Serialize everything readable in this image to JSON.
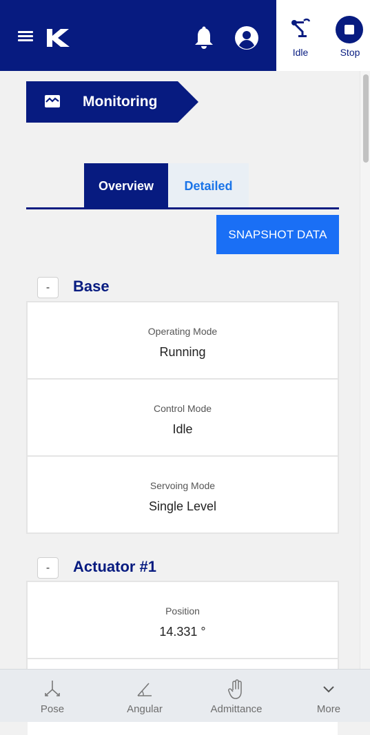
{
  "header": {
    "robot_status_label": "Idle",
    "stop_label": "Stop",
    "colors": {
      "primary": "#071b80",
      "accent": "#1a6ff5"
    }
  },
  "breadcrumb": {
    "label": "Monitoring",
    "icon": "monitoring-icon"
  },
  "tabs": [
    {
      "label": "Overview",
      "active": true
    },
    {
      "label": "Detailed",
      "active": false
    }
  ],
  "snapshot_button": "SNAPSHOT DATA",
  "sections": {
    "base": {
      "toggle": "-",
      "title": "Base",
      "cards": [
        {
          "label": "Operating Mode",
          "value": "Running"
        },
        {
          "label": "Control Mode",
          "value": "Idle"
        },
        {
          "label": "Servoing Mode",
          "value": "Single Level"
        }
      ]
    },
    "actuator1": {
      "toggle": "-",
      "title": "Actuator #1",
      "cards": [
        {
          "label": "Position",
          "value": "14.331 °"
        }
      ]
    }
  },
  "bottom_nav": [
    {
      "label": "Pose",
      "icon": "pose-icon"
    },
    {
      "label": "Angular",
      "icon": "angle-icon"
    },
    {
      "label": "Admittance",
      "icon": "hand-icon"
    },
    {
      "label": "More",
      "icon": "chevron-down-icon"
    }
  ]
}
